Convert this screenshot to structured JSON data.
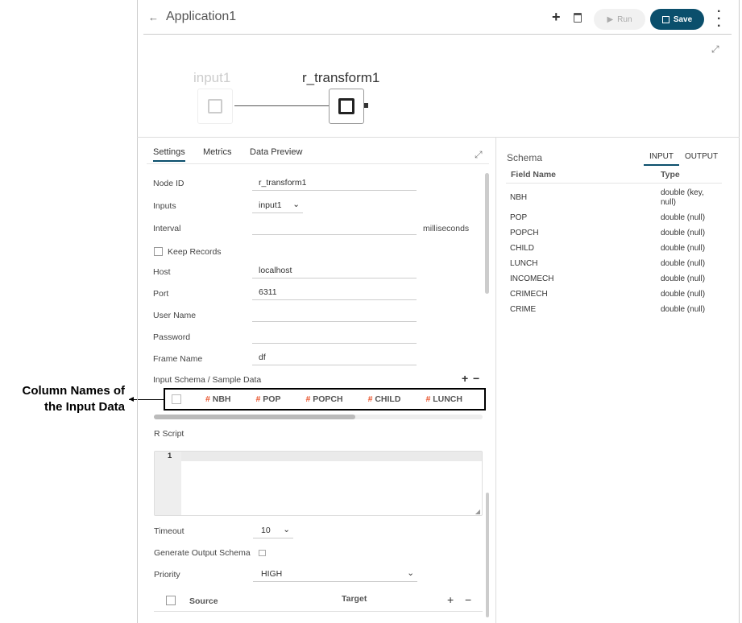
{
  "annotation": {
    "text_line1": "Column Names of",
    "text_line2": "the Input Data"
  },
  "header": {
    "title": "Application1",
    "run_label": "Run",
    "save_label": "Save"
  },
  "canvas": {
    "nodes": [
      {
        "label": "input1"
      },
      {
        "label": "r_transform1"
      }
    ]
  },
  "tabs": [
    {
      "label": "Settings",
      "active": true
    },
    {
      "label": "Metrics"
    },
    {
      "label": "Data Preview"
    }
  ],
  "form": {
    "node_id": {
      "label": "Node ID",
      "value": "r_transform1"
    },
    "inputs": {
      "label": "Inputs",
      "value": "input1"
    },
    "interval": {
      "label": "Interval",
      "value": "",
      "unit": "milliseconds"
    },
    "keep_records": {
      "label": "Keep Records",
      "checked": false
    },
    "host": {
      "label": "Host",
      "value": "localhost"
    },
    "port": {
      "label": "Port",
      "value": "6311"
    },
    "user_name": {
      "label": "User Name",
      "value": ""
    },
    "password": {
      "label": "Password",
      "value": ""
    },
    "frame_name": {
      "label": "Frame Name",
      "value": "df"
    },
    "input_schema": {
      "label": "Input Schema / Sample Data",
      "columns": [
        "NBH",
        "POP",
        "POPCH",
        "CHILD",
        "LUNCH"
      ]
    },
    "r_script": {
      "label": "R Script",
      "line_number": "1"
    },
    "timeout": {
      "label": "Timeout",
      "value": "10"
    },
    "generate_output_schema": {
      "label": "Generate Output Schema"
    },
    "priority": {
      "label": "Priority",
      "value": "HIGH"
    },
    "mapping": {
      "source": "Source",
      "target": "Target"
    }
  },
  "schema": {
    "title": "Schema",
    "tabs": [
      "INPUT",
      "OUTPUT"
    ],
    "headers": [
      "Field Name",
      "Type"
    ],
    "rows": [
      [
        "NBH",
        "double (key, null)"
      ],
      [
        "POP",
        "double (null)"
      ],
      [
        "POPCH",
        "double (null)"
      ],
      [
        "CHILD",
        "double (null)"
      ],
      [
        "LUNCH",
        "double (null)"
      ],
      [
        "INCOMECH",
        "double (null)"
      ],
      [
        "CRIMECH",
        "double (null)"
      ],
      [
        "CRIME",
        "double (null)"
      ]
    ]
  },
  "colors": {
    "accent": "#0b4f6c",
    "hash": "#e8552e"
  }
}
